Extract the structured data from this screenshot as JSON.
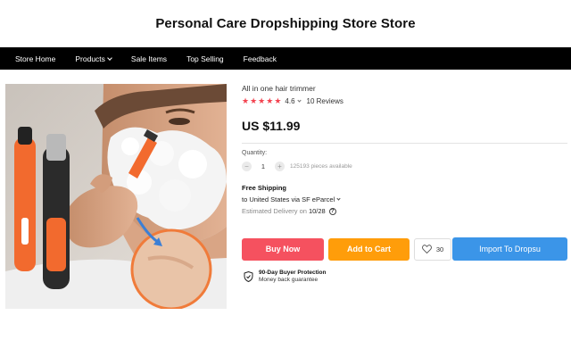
{
  "store": {
    "title": "Personal Care Dropshipping Store Store"
  },
  "nav": {
    "items": [
      {
        "label": "Store Home"
      },
      {
        "label": "Products"
      },
      {
        "label": "Sale Items"
      },
      {
        "label": "Top Selling"
      },
      {
        "label": "Feedback"
      }
    ]
  },
  "product": {
    "name": "All in one hair trimmer",
    "rating": "4.6",
    "stars": 5,
    "reviews": "10 Reviews",
    "price": "US $11.99",
    "quantity_label": "Quantity:",
    "quantity": "1",
    "stock": "125193 pieces available",
    "shipping_title": "Free Shipping",
    "shipping_method": "to United States via SF eParcel",
    "delivery_label": "Estimated Delivery on",
    "delivery_date": "10/28",
    "wishlist_count": "30"
  },
  "actions": {
    "buy_now": "Buy Now",
    "add_to_cart": "Add to Cart",
    "import": "Import To Dropsu"
  },
  "protection": {
    "title": "90-Day Buyer Protection",
    "subtitle": "Money back guarantee"
  },
  "colors": {
    "buy": "#f5515f",
    "cart": "#ff9d0a",
    "import": "#3b95e8",
    "star": "#f3424f",
    "nav_bg": "#000000"
  },
  "icons": [
    "chevron-down-icon",
    "star-icon",
    "minus-icon",
    "plus-icon",
    "help-icon",
    "heart-icon",
    "shield-check-icon"
  ]
}
